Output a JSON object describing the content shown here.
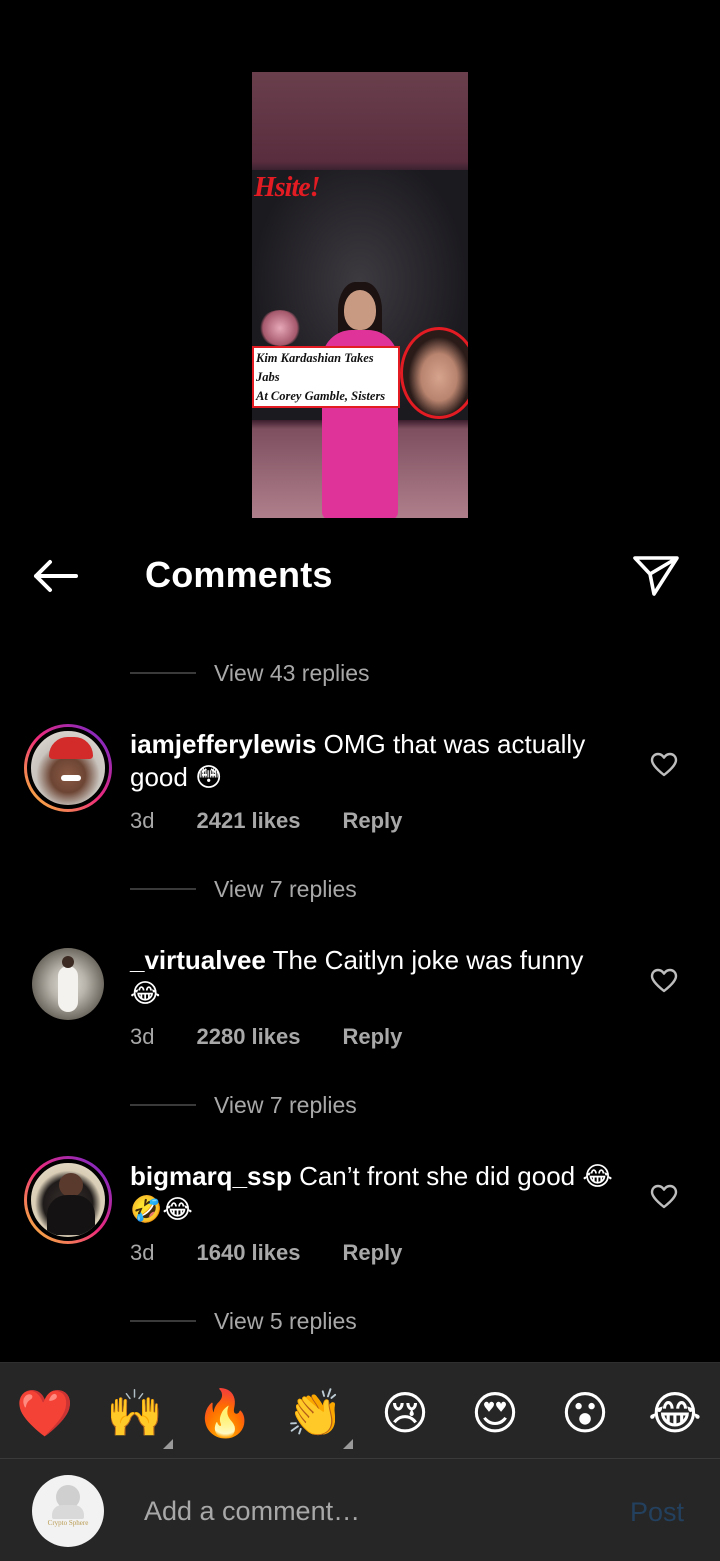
{
  "video": {
    "logo_text": "Hsite!",
    "headline": "Kim Kardashian Takes Jabs\nAt Corey Gamble, Sisters &\nKanye In 'SNL' Monologue"
  },
  "header": {
    "title": "Comments"
  },
  "replies_top": "View 43 replies",
  "comments": [
    {
      "username": "iamjefferylewis",
      "text": "OMG that was actually good",
      "emoji": "😳",
      "age": "3d",
      "likes": "2421 likes",
      "reply_label": "Reply",
      "view_replies": "View 7 replies"
    },
    {
      "username": "_virtualvee",
      "text": "The Caitlyn joke was funny",
      "emoji": "😂",
      "age": "3d",
      "likes": "2280 likes",
      "reply_label": "Reply",
      "view_replies": "View 7 replies"
    },
    {
      "username": "bigmarq_ssp",
      "text": "Can’t front she did good",
      "emoji": "😂🤣😂",
      "age": "3d",
      "likes": "1640 likes",
      "reply_label": "Reply",
      "view_replies": "View 5 replies"
    }
  ],
  "emoji_bar": [
    "❤️",
    "🙌",
    "🔥",
    "👏",
    "😢",
    "😍",
    "😮",
    "😂"
  ],
  "compose": {
    "placeholder": "Add a comment…",
    "post_label": "Post",
    "avatar_text": "Crypto Sphere"
  },
  "colors": {
    "background": "#000000",
    "panel": "#262626",
    "muted_text": "#a8a8a8",
    "post_disabled": "#23405e"
  }
}
